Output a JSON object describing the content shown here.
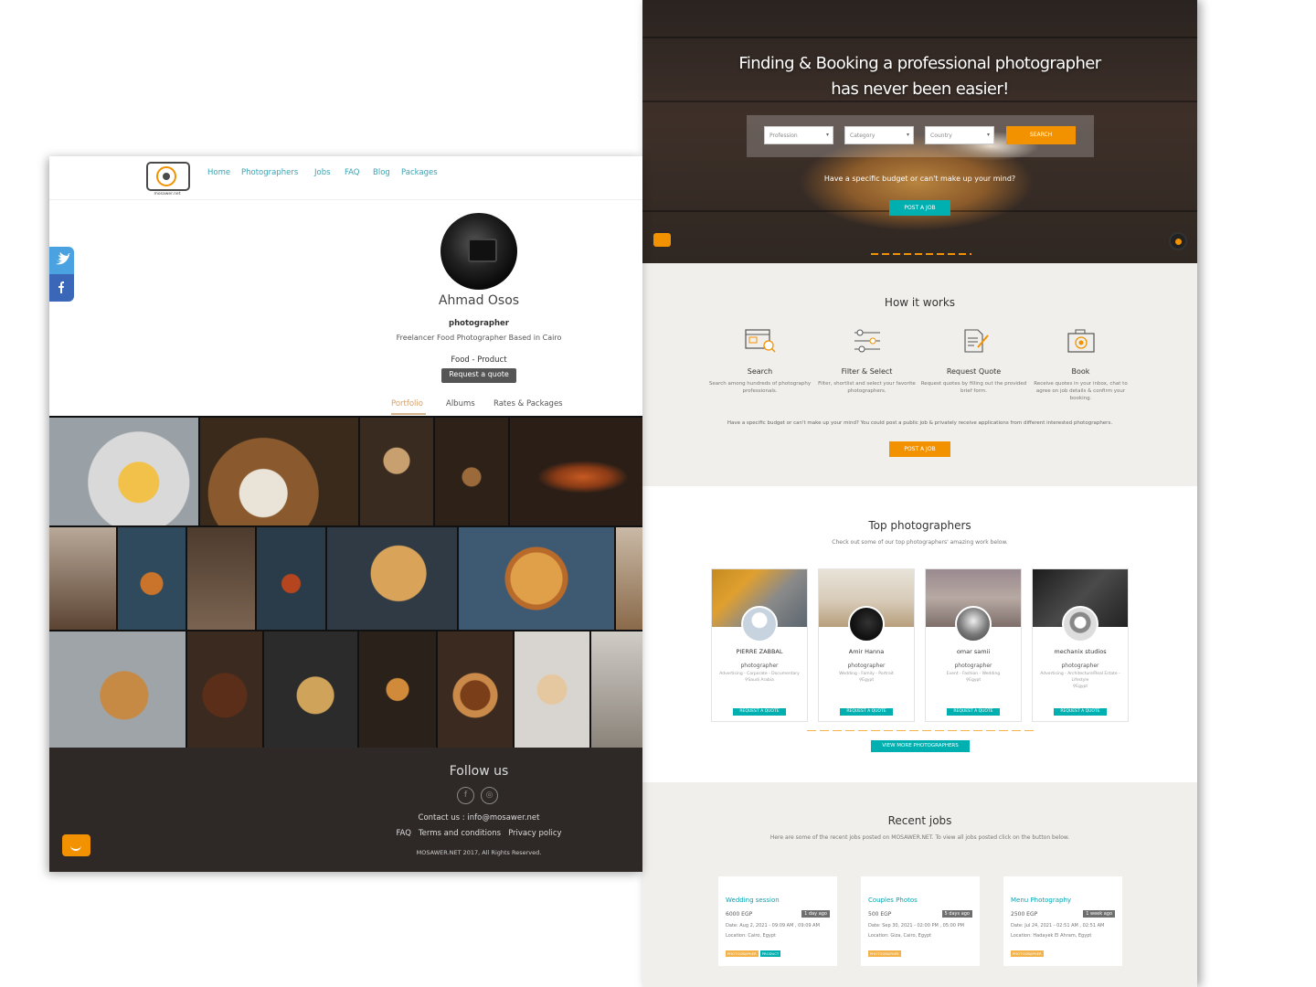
{
  "home": {
    "hero": {
      "title_line1": "Finding & Booking a professional photographer",
      "title_line2": "has never been easier!",
      "selects": [
        "Profession",
        "Category",
        "Country"
      ],
      "search_label": "SEARCH",
      "note": "Have a specific budget or can't make up your mind?",
      "post_job_label": "POST A JOB"
    },
    "how": {
      "title": "How it works",
      "steps": [
        {
          "title": "Search",
          "desc": "Search among hundreds of photography professionals.",
          "icon": "browser-search-icon"
        },
        {
          "title": "Filter & Select",
          "desc": "Filter, shortlist and select your favorite photographers.",
          "icon": "sliders-icon"
        },
        {
          "title": "Request Quote",
          "desc": "Request quotes by filling out the provided brief form.",
          "icon": "document-pen-icon"
        },
        {
          "title": "Book",
          "desc": "Receive quotes in your inbox, chat to agree on job details & confirm your booking.",
          "icon": "camera-icon"
        }
      ],
      "note": "Have a specific budget or can't make up your mind? You could post a public job & privately receive applications from different interested photographers.",
      "post_job_label": "POST A JOB"
    },
    "top": {
      "title": "Top photographers",
      "subtitle": "Check out some of our top photographers' amazing work below.",
      "cards": [
        {
          "name": "PIERRE ZABBAL",
          "role": "photographer",
          "categories": "Advertising - Corporate - Documentary",
          "location": "Saudi Arabia",
          "request_label": "REQUEST A QUOTE"
        },
        {
          "name": "Amir Hanna",
          "role": "photographer",
          "categories": "Wedding - Family - Portrait",
          "location": "Egypt",
          "request_label": "REQUEST A QUOTE"
        },
        {
          "name": "omar samii",
          "role": "photographer",
          "categories": "Event - Fashion - Wedding",
          "location": "Egypt",
          "request_label": "REQUEST A QUOTE"
        },
        {
          "name": "mechanix studios",
          "role": "photographer",
          "categories": "Advertising - Architecture/Real Estate - Lifestyle",
          "location": "Egypt",
          "request_label": "REQUEST A QUOTE"
        }
      ],
      "view_more_label": "VIEW MORE PHOTOGRAPHERS"
    },
    "jobs": {
      "title": "Recent jobs",
      "subtitle": "Here are some of the recent jobs posted on MOSAWER.NET. To view all jobs posted click on the button below.",
      "cards": [
        {
          "title": "Wedding session",
          "price": "6000 EGP",
          "age": "1 day ago",
          "date": "Date: Aug 2, 2021 - 09:09 AM , 09:09 AM",
          "location": "Location: Cairo, Egypt",
          "tags": [
            "PHOTOGRAPHER",
            "PRODUCT"
          ]
        },
        {
          "title": "Couples Photos",
          "price": "500 EGP",
          "age": "5 days ago",
          "date": "Date: Sep 30, 2021 - 02:00 PM , 05:00 PM",
          "location": "Location: Giza, Cairo, Egypt",
          "tags": [
            "PHOTOGRAPHER"
          ]
        },
        {
          "title": "Menu Photography",
          "price": "2500 EGP",
          "age": "1 week ago",
          "date": "Date: Jul 24, 2021 - 02:51 AM , 02:51 AM",
          "location": "Location: Hadayek El Ahram, Egypt",
          "tags": [
            "PHOTOGRAPHER"
          ]
        }
      ]
    }
  },
  "profile": {
    "logo_text": "mosawer.net",
    "nav": [
      "Home",
      "Photographers",
      "Jobs",
      "FAQ",
      "Blog",
      "Packages"
    ],
    "name": "Ahmad Osos",
    "role": "photographer",
    "description": "Freelancer Food Photographer Based in Cairo",
    "categories": "Food - Product",
    "request_label": "Request a quote",
    "tabs": [
      "Portfolio",
      "Albums",
      "Rates & Packages"
    ],
    "footer": {
      "follow": "Follow us",
      "contact": "Contact us : info@mosawer.net",
      "links": [
        "FAQ",
        "Terms and conditions",
        "Privacy policy"
      ],
      "copyright": "MOSAWER.NET 2017, All Rights Reserved."
    }
  },
  "colors": {
    "accent_orange": "#f39200",
    "accent_teal": "#00b0b0",
    "link_blue": "#3aa3b3",
    "footer_dark": "#2e2927",
    "twitter_blue": "#4aa3e0",
    "facebook_blue": "#3b67b8"
  }
}
